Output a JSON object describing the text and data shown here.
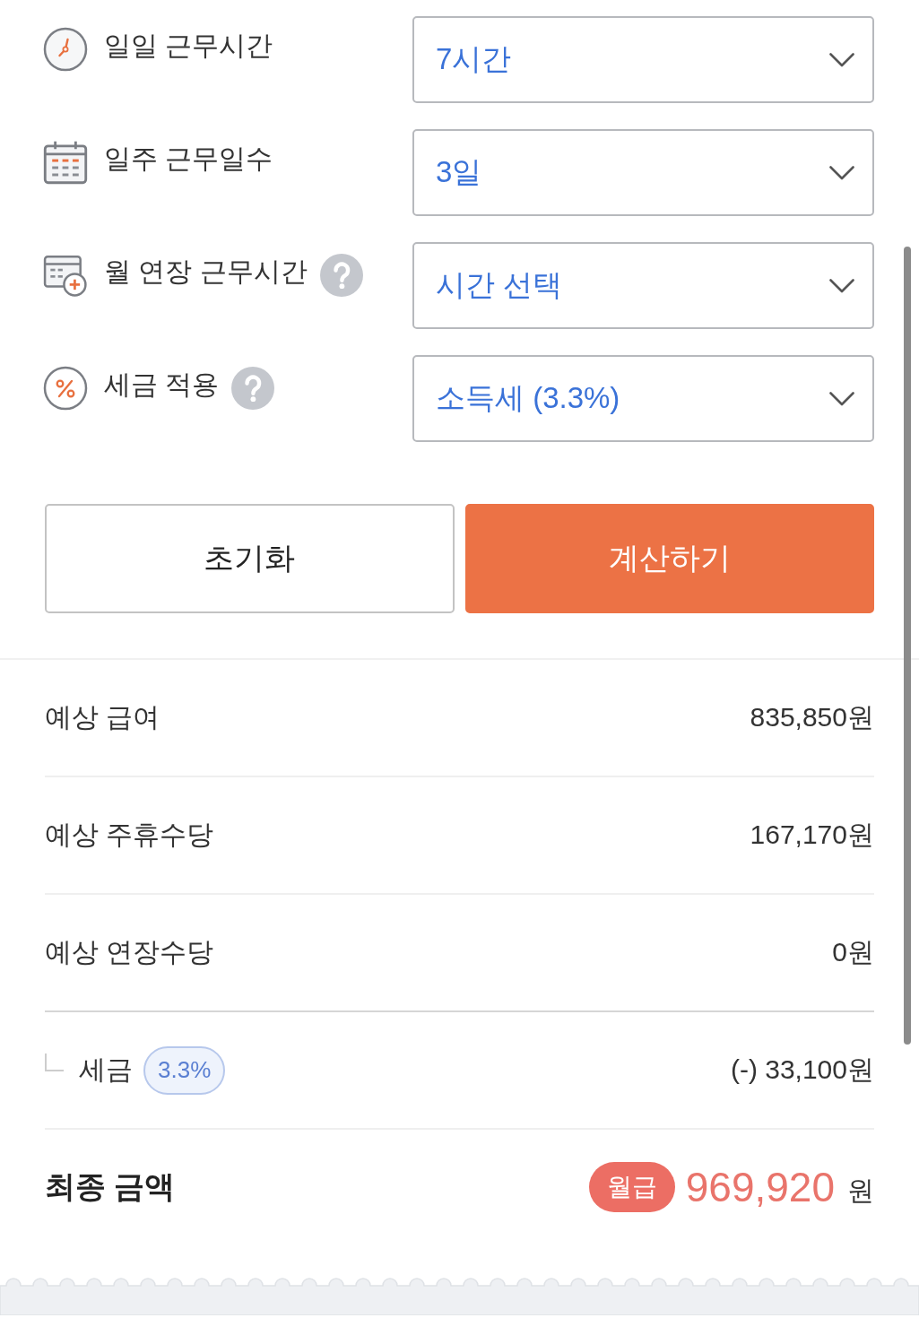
{
  "form_fields": [
    {
      "kind": "clock",
      "label": "일일 근무시간",
      "help": false,
      "value": "7시간"
    },
    {
      "kind": "calendar",
      "label": "일주 근무일수",
      "help": false,
      "value": "3일"
    },
    {
      "kind": "calendar_plus",
      "label": "월 연장 근무시간",
      "help": true,
      "value": "시간 선택"
    },
    {
      "kind": "percent",
      "label": "세금 적용",
      "help": true,
      "value": "소득세 (3.3%)"
    }
  ],
  "buttons": [
    {
      "kind": "reset",
      "label": "초기화"
    },
    {
      "kind": "submit",
      "label": "계산하기"
    }
  ],
  "results": [
    {
      "kind": "item",
      "label": "예상 급여",
      "value": "835,850원"
    },
    {
      "kind": "item",
      "label": "예상 주휴수당",
      "value": "167,170원"
    },
    {
      "kind": "item",
      "label": "예상 연장수당",
      "value": "0원"
    },
    {
      "kind": "sub",
      "label": "세금",
      "badge": "3.3%",
      "value": "(-) 33,100원"
    }
  ],
  "total": {
    "label": "최종 금액",
    "badge": "월급",
    "amount": "969,920",
    "unit": "원"
  }
}
